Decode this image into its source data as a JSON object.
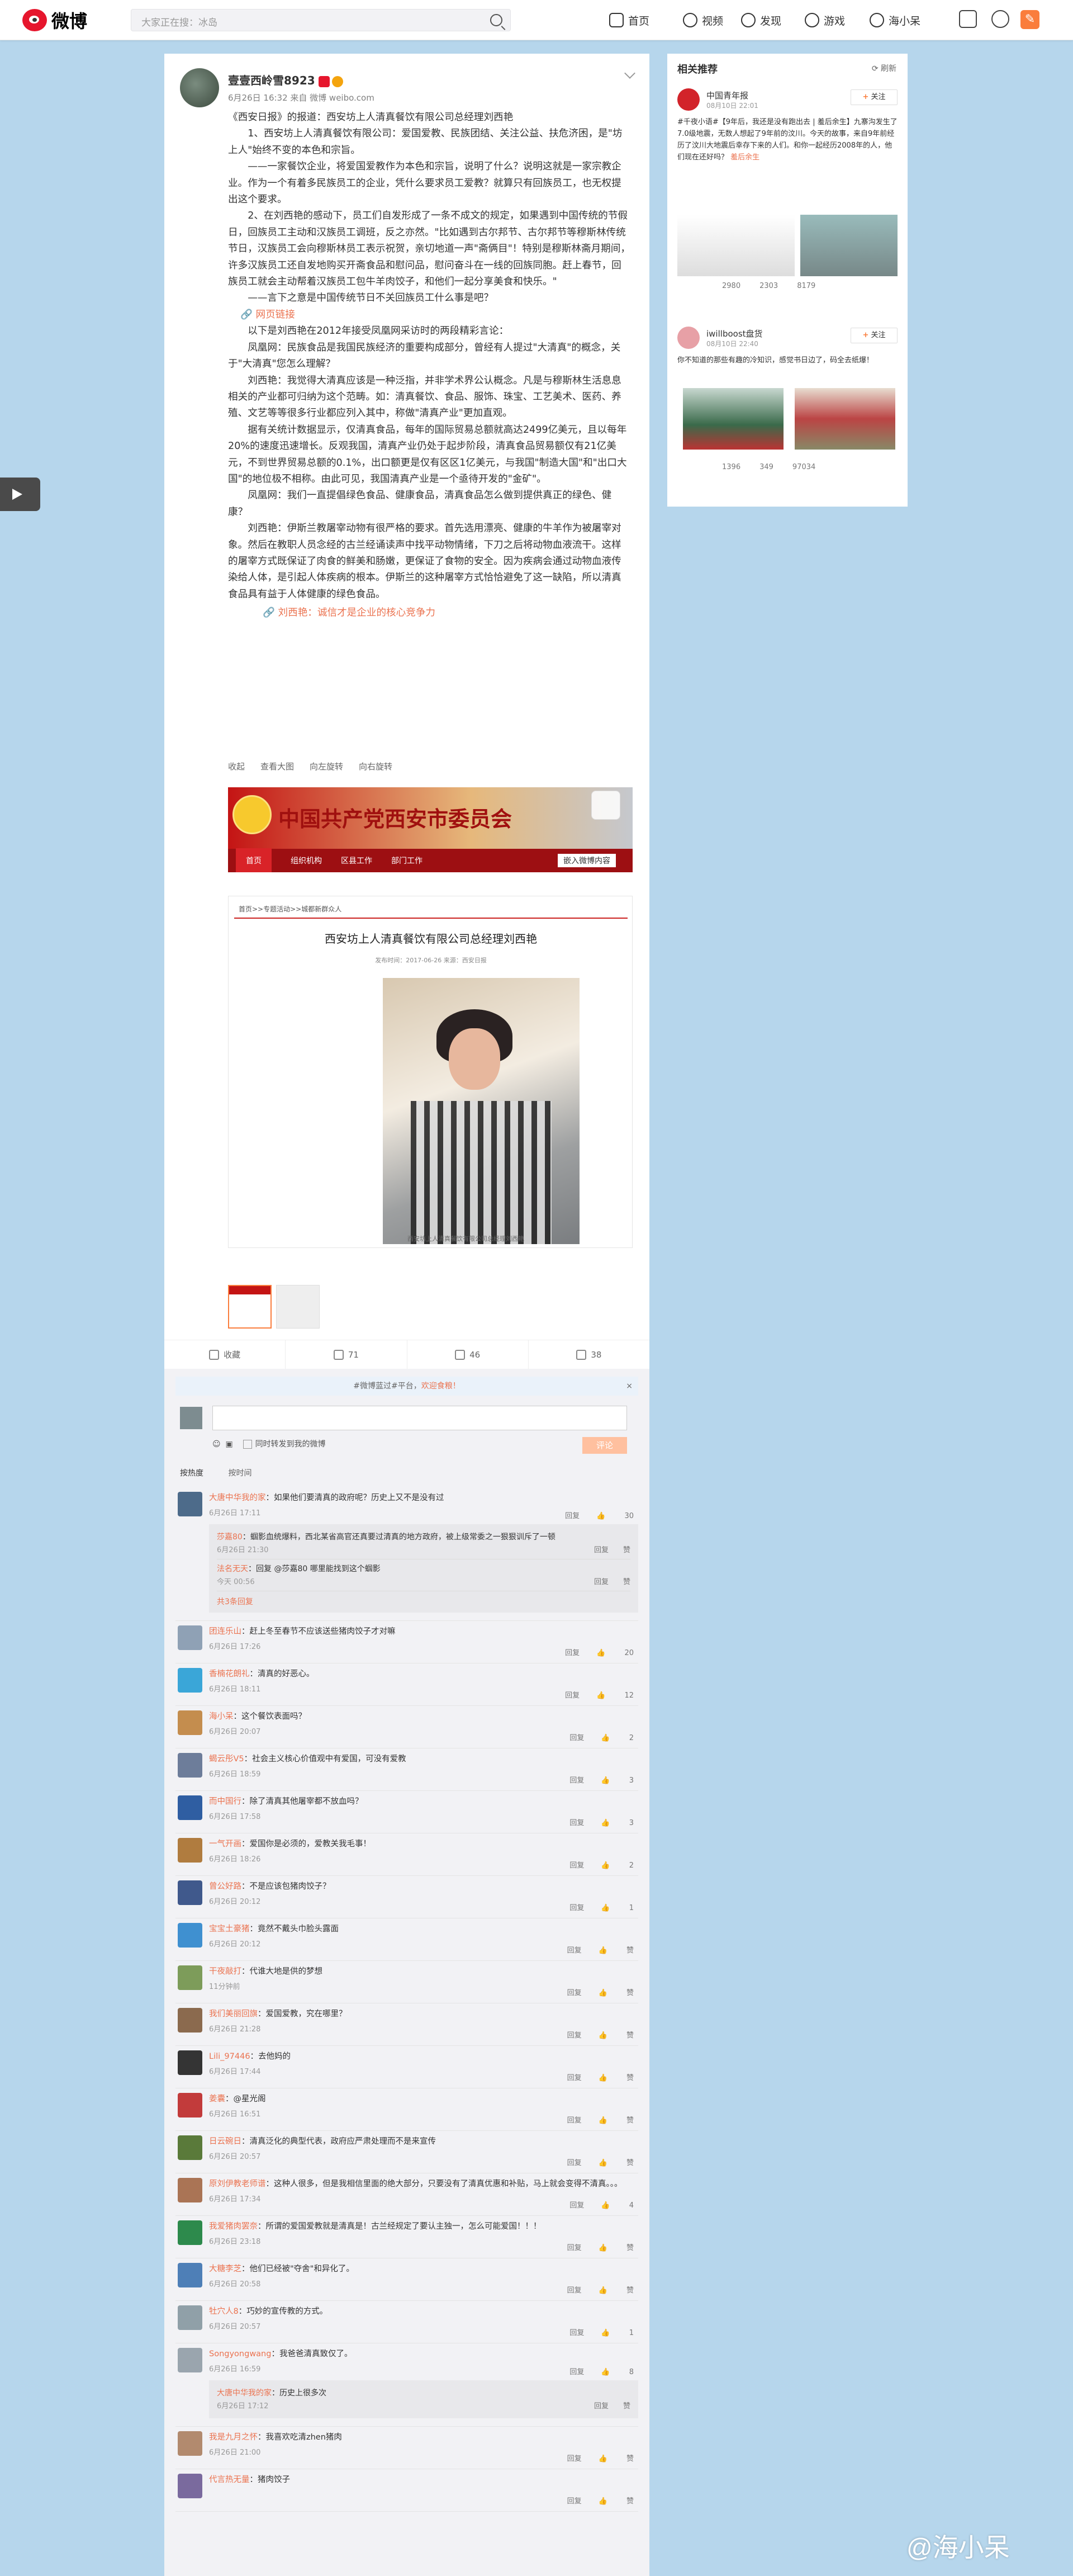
{
  "header": {
    "logo": "微博",
    "search_placeholder": "大家正在搜：冰岛",
    "nav": [
      "首页",
      "视频",
      "发现",
      "游戏",
      "海小呆"
    ]
  },
  "post": {
    "author": "壹壹西岭雪8923",
    "meta": "6月26日 16:32 来自 微博 weibo.com",
    "paragraphs": [
      "《西安日报》的报道：西安坊上人清真餐饮有限公司总经理刘西艳",
      "　　1、西安坊上人清真餐饮有限公司：爱国爱教、民族团结、关注公益、扶危济困，是\"坊上人\"始终不变的本色和宗旨。",
      "　　——一家餐饮企业，将爱国爱教作为本色和宗旨，说明了什么？说明这就是一家宗教企业。作为一个有着多民族员工的企业，凭什么要求员工爱教？就算只有回族员工，也无权提出这个要求。",
      "　　2、在刘西艳的感动下，员工们自发形成了一条不成文的规定，如果遇到中国传统的节假日，回族员工主动和汉族员工调班，反之亦然。\"比如遇到古尔邦节、古尔邦节等穆斯林传统节日，汉族员工会向穆斯林员工表示祝贺，亲切地道一声\"斋俩目\"！特别是穆斯林斋月期间，许多汉族员工还自发地购买开斋食品和慰问品，慰问奋斗在一线的回族同胞。赶上春节，回族员工就会主动帮着汉族员工包牛羊肉饺子，和他们一起分享美食和快乐。\"",
      "　　——言下之意是中国传统节日不关回族员工什么事是吧？"
    ],
    "link1": "网页链接",
    "paragraphs2": [
      "　　以下是刘西艳在2012年接受凤凰网采访时的两段精彩言论：",
      "　　凤凰网：民族食品是我国民族经济的重要构成部分，曾经有人提过\"大清真\"的概念，关于\"大清真\"您怎么理解？",
      "　　刘西艳：我觉得大清真应该是一种泛指，并非学术界公认概念。凡是与穆斯林生活息息相关的产业都可归纳为这个范畴。如：清真餐饮、食品、服饰、珠宝、工艺美术、医药、养殖、文艺等等很多行业都应列入其中，称做\"清真产业\"更加直观。",
      "　　据有关统计数据显示，仅清真食品，每年的国际贸易总额就高达2499亿美元，且以每年20%的速度迅速增长。反观我国，清真产业仍处于起步阶段，清真食品贸易额仅有21亿美元，不到世界贸易总额的0.1%，出口额更是仅有区区1亿美元，与我国\"制造大国\"和\"出口大国\"的地位极不相称。由此可见，我国清真产业是一个亟待开发的\"金矿\"。",
      "　　凤凰网：我们一直提倡绿色食品、健康食品，清真食品怎么做到提供真正的绿色、健康？",
      "　　刘西艳：伊斯兰教屠宰动物有很严格的要求。首先选用漂亮、健康的牛羊作为被屠宰对象。然后在教职人员念经的古兰经诵读声中找平动物情绪，下刀之后将动物血液流干。这样的屠宰方式既保证了肉食的鲜美和肠嫩，更保证了食物的安全。因为疾病会通过动物血液传染给人体，是引起人体疾病的根本。伊斯兰的这种屠宰方式恰恰避免了这一缺陷，所以清真食品具有益于人体健康的绿色食品。"
    ],
    "link2": "刘西艳：诚信才是企业的核心竞争力",
    "img_tools": [
      "收起",
      "查看大图",
      "向左旋转",
      "向右旋转"
    ],
    "banner": {
      "title": "中国共产党西安市委员会",
      "menu": [
        "首页",
        "组织机构",
        "区县工作",
        "部门工作"
      ],
      "sub": "嵌入微博内容"
    },
    "article": {
      "crumb": "首页>>专题活动>>城都新群众人",
      "title": "西安坊上人清真餐饮有限公司总经理刘西艳",
      "src": "发布时间：2017-06-26 来源：西安日报",
      "caption": "西安坊上人清真餐饮有限公司总经理刘西艳"
    },
    "actions": [
      "收藏",
      "71",
      "46",
      "38"
    ]
  },
  "comments": {
    "tip": "#微博蓝过#平台，",
    "tip_hl": "欢迎食粮！",
    "forward_label": "同时转发到我的微博",
    "send": "评论",
    "sort": [
      "按热度",
      "按时间"
    ],
    "items": [
      {
        "name": "大唐中华我的家",
        "text": "：如果他们要清真的政府呢？历史上又不是没有过",
        "time": "6月26日 17:11",
        "likes": "30",
        "color": "#4d6b8a",
        "subs": [
          {
            "name": "莎嘉80",
            "text": "：蝈影血统爆料，西北某省高官还真要过清真的地方政府，被上级常委之一狠狠训斥了一顿",
            "time": "6月26日 21:30"
          },
          {
            "name": "法名无天",
            "text": "：回复 @莎嘉80 哪里能找到这个蝈影",
            "time": "今天 00:56"
          }
        ],
        "more": "共3条回复"
      },
      {
        "name": "团连乐山",
        "text": "：赶上冬至春节不应该送些猪肉饺子才对嘛",
        "time": "6月26日 17:26",
        "likes": "20",
        "color": "#8fa1b5"
      },
      {
        "name": "香楠花朗礼",
        "text": "：清真的好恶心。",
        "time": "6月26日 18:11",
        "likes": "12",
        "color": "#3aa6d8"
      },
      {
        "name": "海小呆",
        "text": "：这个餐饮表面吗？",
        "time": "6月26日 20:07",
        "likes": "2",
        "color": "#c48d4e"
      },
      {
        "name": "蝎云彤V5",
        "text": "：社会主义核心价值观中有爱国，可没有爱教",
        "time": "6月26日 18:59",
        "likes": "3",
        "color": "#6d7d9a"
      },
      {
        "name": "而中国行",
        "text": "：除了清真其他屠宰都不放血吗？",
        "time": "6月26日 17:58",
        "likes": "3",
        "color": "#2f5ea2"
      },
      {
        "name": "一气开画",
        "text": "：爱国你是必须的，爱教关我毛事！",
        "time": "6月26日 18:26",
        "likes": "2",
        "color": "#b07c3f"
      },
      {
        "name": "曾公好路",
        "text": "：不是应该包猪肉饺子？",
        "time": "6月26日 20:12",
        "likes": "1",
        "color": "#40598c"
      },
      {
        "name": "宝宝土豪猪",
        "text": "：竟然不戴头巾脸头露面",
        "time": "6月26日 20:12",
        "likes": "",
        "color": "#3f90d0"
      },
      {
        "name": "干夜敲打",
        "text": "：代谁大地是供的梦想",
        "time": "11分钟前",
        "likes": "",
        "color": "#7d9c5a"
      },
      {
        "name": "我们美丽回旗",
        "text": "：爱国爱教，究在哪里？",
        "time": "6月26日 21:28",
        "likes": "",
        "color": "#8b6a4e"
      },
      {
        "name": "Lili_97446",
        "text": "：去他妈的",
        "time": "6月26日 17:44",
        "likes": "",
        "color": "#343434"
      },
      {
        "name": "姜囊",
        "text": "：@星光阁",
        "time": "6月26日 16:51",
        "likes": "",
        "color": "#c23b3b"
      },
      {
        "name": "日云碗日",
        "text": "：清真泛化的典型代表，政府应严肃处理而不是来宣传",
        "time": "6月26日 20:57",
        "likes": "",
        "color": "#5a7a3a"
      },
      {
        "name": "原刘伊教老师谱",
        "text": "：这种人很多，但是我相信里面的绝大部分，只要没有了清真优惠和补贴，马上就会变得不清真。。。",
        "time": "6月26日 17:34",
        "likes": "4",
        "color": "#aa7455"
      },
      {
        "name": "我爱猪肉罢奈",
        "text": "：所谓的爱国爱教就是清真是！古兰经规定了要认主独一，怎么可能爱国！！！",
        "time": "6月26日 23:18",
        "likes": "",
        "color": "#2d8a4c"
      },
      {
        "name": "大糖李芝",
        "text": "：他们已经被\"夺舍\"和异化了。",
        "time": "6月26日 20:58",
        "likes": "",
        "color": "#4e7fb7"
      },
      {
        "name": "牡穴人8",
        "text": "：巧妙的宣传教的方式。",
        "time": "6月26日 20:57",
        "likes": "1",
        "color": "#90a0a8"
      },
      {
        "name": "Songyongwang",
        "text": "：我爸爸清真致仅了。",
        "time": "6月26日 16:59",
        "likes": "8",
        "color": "#9aa5ae",
        "subs": [
          {
            "name": "大唐中华我的家",
            "text": "：历史上很多次",
            "time": "6月26日 17:12"
          }
        ]
      },
      {
        "name": "我是九月之怀",
        "text": "：我喜欢吃清zhen猪肉",
        "time": "6月26日 21:00",
        "likes": "",
        "color": "#b28a6e"
      },
      {
        "name": "代言热无量",
        "text": "：猪肉饺子",
        "time": "",
        "likes": "",
        "color": "#7a6a9e"
      }
    ],
    "reply": "回复",
    "like": "赞"
  },
  "sidebar": {
    "title": "相关推荐",
    "refresh": "刷新",
    "follow": "关注",
    "cards": [
      {
        "name": "中国青年报",
        "time": "08月10日 22:01",
        "text": "#千夜小语#【9年后，我还是没有跑出去 | 羞后余生】九寨沟发生了7.0级地震，无数人想起了9年前的汶川。今天的故事，来自9年前经历了汶川大地震后幸存下来的人们。和你一起经历2008年的人，他们现在还好吗？",
        "link": "羞后余生",
        "counts": [
          "2980",
          "2303",
          "8179"
        ]
      },
      {
        "name": "iwillboost盘货",
        "time": "08月10日 22:40",
        "text": "你不知道的那些有趣的冷知识，感觉书日边了，码全去纸爆！",
        "counts": [
          "1396",
          "349",
          "97034"
        ]
      }
    ]
  },
  "watermark": "@海小呆"
}
